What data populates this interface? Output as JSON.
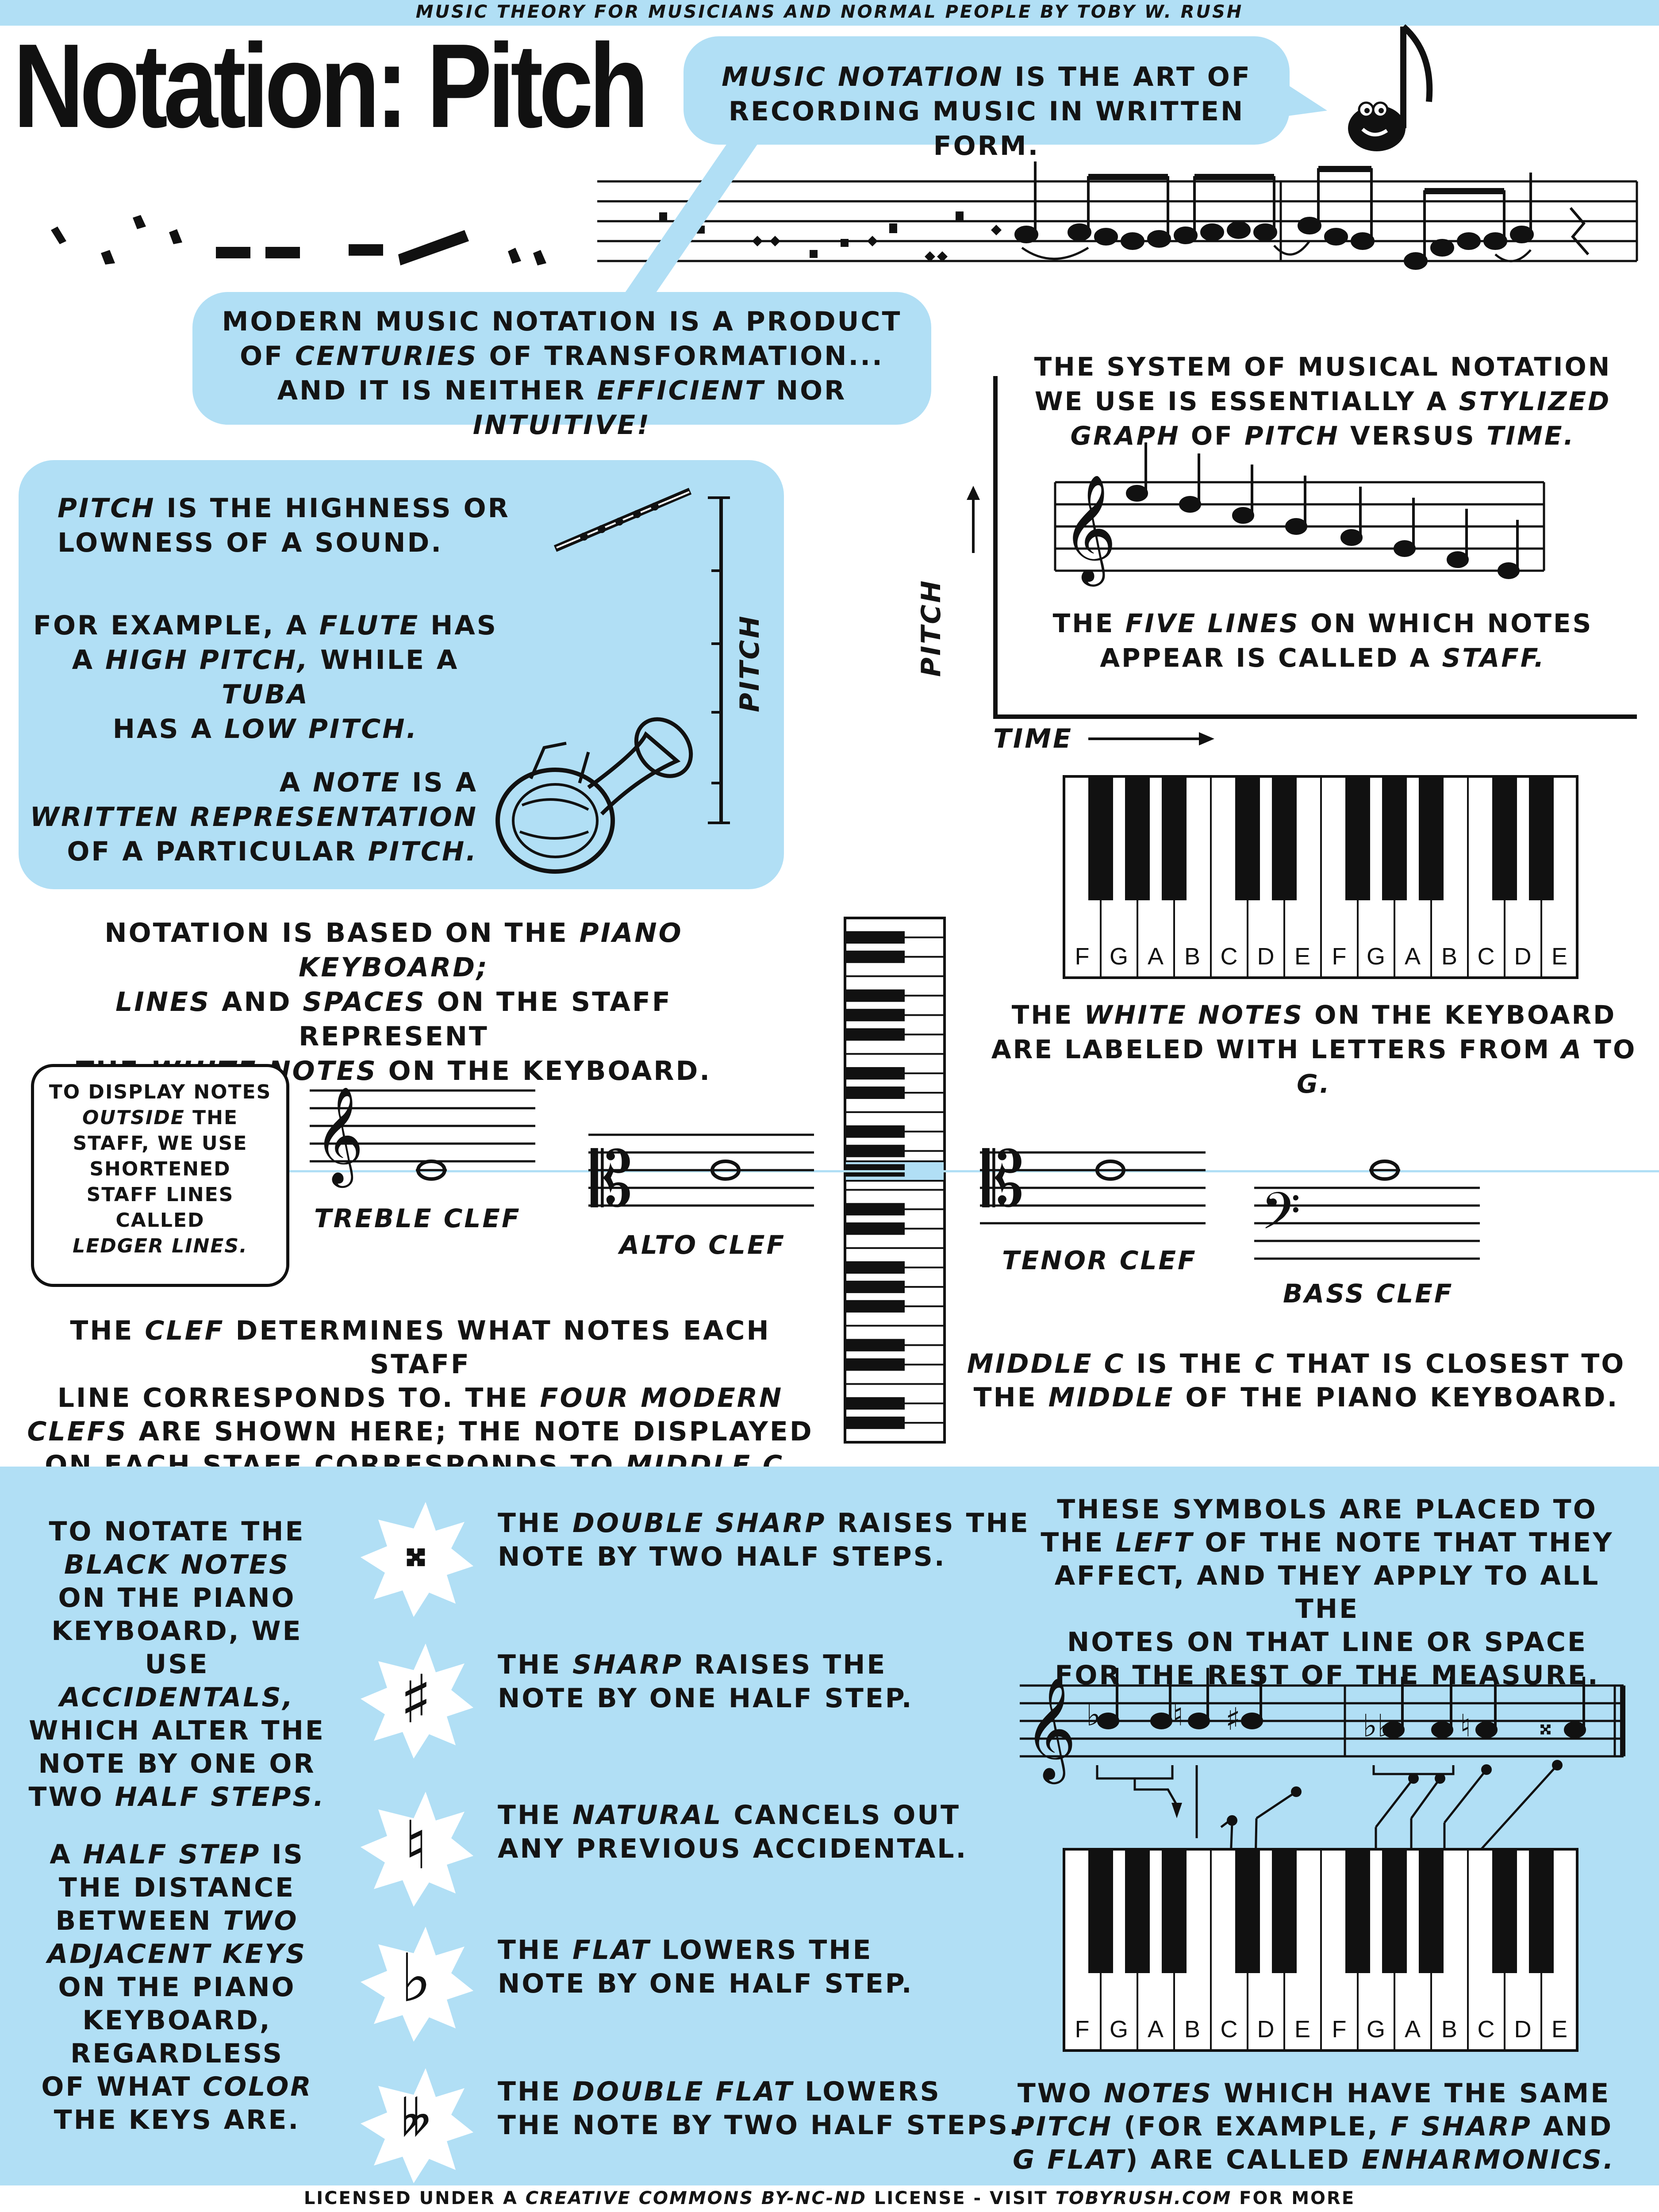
{
  "header": {
    "series": "MUSIC THEORY FOR MUSICIANS AND NORMAL PEOPLE BY TOBY W. RUSH",
    "title": "Notation: Pitch"
  },
  "intro": {
    "bubble_a": [
      "MUSIC NOTATION",
      " IS THE ART OF",
      "RECORDING MUSIC IN WRITTEN FORM."
    ],
    "bubble_b": [
      "MODERN MUSIC NOTATION IS A PRODUCT",
      "OF ",
      "CENTURIES",
      " OF TRANSFORMATION...",
      "AND IT IS NEITHER ",
      "EFFICIENT",
      " NOR ",
      "INTUITIVE!"
    ]
  },
  "graph": {
    "lead": [
      "THE SYSTEM OF MUSICAL NOTATION",
      "WE USE IS ESSENTIALLY A ",
      "STYLIZED",
      "GRAPH",
      " OF ",
      "PITCH",
      " VERSUS ",
      "TIME."
    ],
    "staff_caption": [
      "THE ",
      "FIVE LINES",
      " ON WHICH NOTES",
      "APPEAR IS CALLED A ",
      "STAFF."
    ],
    "pitch_axis": "PITCH",
    "time_axis": "TIME"
  },
  "pitch_box": {
    "p1": [
      "PITCH",
      " IS THE HIGHNESS OR",
      "LOWNESS OF A SOUND."
    ],
    "p2": [
      "FOR EXAMPLE, A ",
      "FLUTE",
      " HAS",
      "A ",
      "HIGH PITCH,",
      " WHILE A ",
      "TUBA",
      "HAS A ",
      "LOW PITCH."
    ],
    "p3": [
      "A ",
      "NOTE",
      " IS A",
      "WRITTEN REPRESENTATION",
      "OF A PARTICULAR ",
      "PITCH."
    ],
    "axis_label": "PITCH"
  },
  "keyboard": {
    "labels": [
      "F",
      "G",
      "A",
      "B",
      "C",
      "D",
      "E",
      "F",
      "G",
      "A",
      "B",
      "C",
      "D",
      "E"
    ],
    "caption": [
      "THE ",
      "WHITE NOTES",
      " ON THE KEYBOARD",
      "ARE LABELED WITH LETTERS FROM ",
      "A",
      " TO ",
      "G."
    ]
  },
  "notation_text": [
    "NOTATION IS BASED ON THE ",
    "PIANO KEYBOARD;",
    "LINES",
    " AND ",
    "SPACES",
    " ON THE STAFF REPRESENT",
    "THE ",
    "WHITE NOTES",
    " ON THE KEYBOARD."
  ],
  "ledger_box": [
    "TO DISPLAY NOTES",
    "OUTSIDE",
    " THE",
    "STAFF, WE USE",
    "SHORTENED",
    "STAFF LINES",
    "CALLED",
    "LEDGER LINES."
  ],
  "clefs": {
    "treble": "TREBLE CLEF",
    "alto": "ALTO CLEF",
    "tenor": "TENOR CLEF",
    "bass": "BASS CLEF"
  },
  "clef_text": [
    "THE ",
    "CLEF",
    " DETERMINES WHAT NOTES EACH STAFF",
    "LINE CORRESPONDS TO. THE ",
    "FOUR MODERN",
    "CLEFS",
    " ARE SHOWN HERE; THE NOTE DISPLAYED",
    "ON EACH STAFF CORRESPONDS TO ",
    "MIDDLE C."
  ],
  "middle_c_text": [
    "MIDDLE C",
    " IS THE ",
    "C",
    " THAT IS CLOSEST TO",
    "THE ",
    "MIDDLE",
    " OF THE PIANO KEYBOARD."
  ],
  "accidentals": {
    "intro": [
      "TO NOTATE THE",
      "BLACK NOTES",
      "ON THE PIANO",
      "KEYBOARD, WE USE",
      "ACCIDENTALS,",
      "WHICH ALTER THE",
      "NOTE BY ONE OR",
      "TWO ",
      "HALF STEPS."
    ],
    "half_step": [
      "A ",
      "HALF STEP",
      " IS",
      "THE DISTANCE",
      "BETWEEN ",
      "TWO",
      "ADJACENT KEYS",
      "ON THE PIANO",
      "KEYBOARD,",
      "REGARDLESS",
      "OF WHAT ",
      "COLOR",
      "THE KEYS ARE."
    ],
    "items": [
      {
        "symbol": "𝄪",
        "icon": "double-sharp-icon",
        "text": [
          "THE ",
          "DOUBLE SHARP",
          " RAISES THE",
          "NOTE BY TWO HALF STEPS."
        ]
      },
      {
        "symbol": "♯",
        "icon": "sharp-icon",
        "text": [
          "THE ",
          "SHARP",
          " RAISES THE",
          "NOTE BY ONE HALF STEP."
        ]
      },
      {
        "symbol": "♮",
        "icon": "natural-icon",
        "text": [
          "THE ",
          "NATURAL",
          " CANCELS OUT",
          "ANY PREVIOUS ACCIDENTAL."
        ]
      },
      {
        "symbol": "♭",
        "icon": "flat-icon",
        "text": [
          "THE ",
          "FLAT",
          " LOWERS THE",
          "NOTE BY ONE HALF STEP."
        ]
      },
      {
        "symbol": "𝄫",
        "icon": "double-flat-icon",
        "text": [
          "THE ",
          "DOUBLE FLAT",
          " LOWERS",
          "THE NOTE BY TWO HALF STEPS."
        ]
      }
    ],
    "placement": [
      "THESE SYMBOLS ARE PLACED TO",
      "THE ",
      "LEFT",
      " OF THE NOTE THAT THEY",
      "AFFECT, AND THEY APPLY TO ALL THE",
      "NOTES ON THAT LINE OR SPACE",
      "FOR THE REST OF THE MEASURE."
    ],
    "enharmonic": [
      "TWO ",
      "NOTES",
      " WHICH HAVE THE SAME",
      "PITCH",
      " (FOR EXAMPLE, ",
      "F SHARP",
      " AND",
      "G FLAT",
      ") ARE CALLED ",
      "ENHARMONICS."
    ]
  },
  "footer": [
    "LICENSED UNDER A ",
    "CREATIVE COMMONS BY-NC-ND",
    " LICENSE - VISIT ",
    "TOBYRUSH.COM",
    " FOR MORE"
  ],
  "colors": {
    "accent": "#b1dff5",
    "ink": "#141414"
  }
}
